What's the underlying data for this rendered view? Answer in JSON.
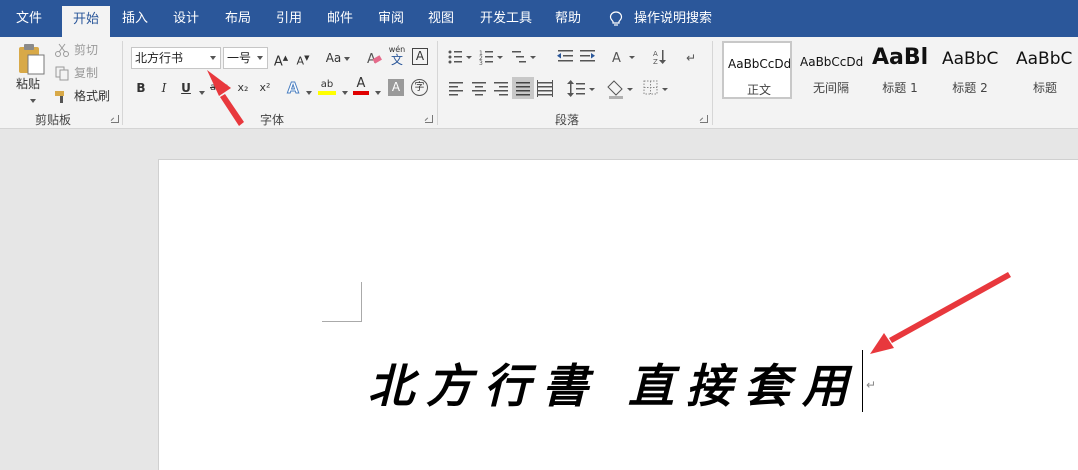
{
  "tabs": [
    {
      "label": "文件"
    },
    {
      "label": "开始"
    },
    {
      "label": "插入"
    },
    {
      "label": "设计"
    },
    {
      "label": "布局"
    },
    {
      "label": "引用"
    },
    {
      "label": "邮件"
    },
    {
      "label": "审阅"
    },
    {
      "label": "视图"
    },
    {
      "label": "开发工具"
    },
    {
      "label": "帮助"
    }
  ],
  "active_tab": "开始",
  "search": {
    "label": "操作说明搜索",
    "icon": "lightbulb-icon"
  },
  "clipboard": {
    "paste_label": "粘贴",
    "cut_label": "剪切",
    "copy_label": "复制",
    "format_painter_label": "格式刷",
    "group_label": "剪贴板"
  },
  "font": {
    "font_name": "北方行书",
    "font_size": "一号",
    "case_label": "Aa",
    "phonetic_label": "wén",
    "phonetic_char": "文",
    "border_char": "A",
    "bold": "B",
    "italic": "I",
    "underline": "U",
    "strike": "abc",
    "subscript": "x₂",
    "superscript": "x²",
    "highlight": "ab",
    "font_color": "A",
    "shade": "A",
    "enclose": "字",
    "group_label": "字体",
    "colors": {
      "highlight": "#ffff00",
      "font_color": "#e00000"
    }
  },
  "paragraph": {
    "group_label": "段落"
  },
  "styles": [
    {
      "preview": "AaBbCcDd",
      "name": "正文",
      "selected": true
    },
    {
      "preview": "AaBbCcDd",
      "name": "无间隔",
      "selected": false
    },
    {
      "preview": "AaBl",
      "name": "标题 1",
      "selected": false
    },
    {
      "preview": "AaBbC",
      "name": "标题 2",
      "selected": false
    },
    {
      "preview": "AaBbC",
      "name": "标题",
      "selected": false
    }
  ],
  "document": {
    "text": "北方行書 直接套用",
    "paragraph_mark": "↵"
  },
  "colors": {
    "accent": "#2b579a",
    "ribbon": "#f3f3f3",
    "annotation": "#e8383d"
  }
}
